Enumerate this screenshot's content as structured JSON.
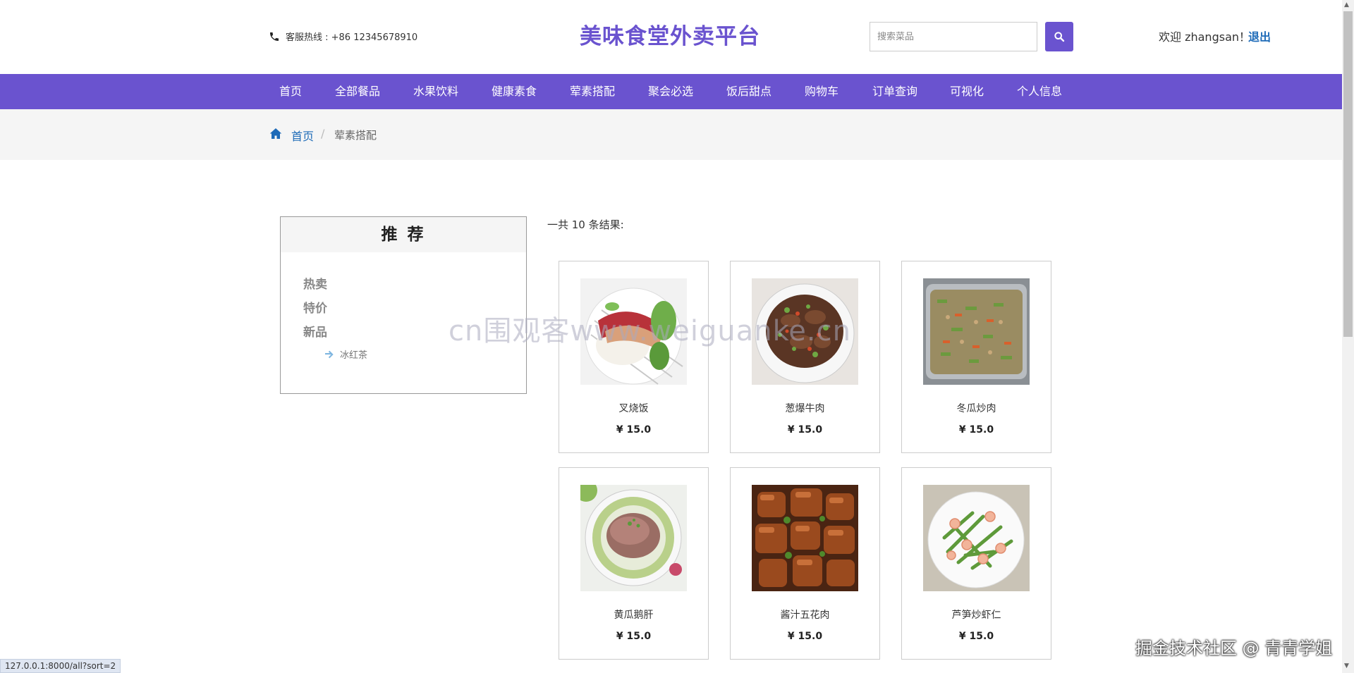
{
  "header": {
    "hotline": "客服热线 : +86 12345678910",
    "title": "美味食堂外卖平台",
    "search_placeholder": "搜索菜品",
    "welcome": "欢迎 zhangsan！",
    "logout": "退出",
    "brand_color": "#6a53cf"
  },
  "nav": [
    "首页",
    "全部餐品",
    "水果饮料",
    "健康素食",
    "荤素搭配",
    "聚会必选",
    "饭后甜点",
    "购物车",
    "订单查询",
    "可视化",
    "个人信息"
  ],
  "breadcrumb": {
    "home": "首页",
    "separator": "/",
    "current": "荤素搭配"
  },
  "sidebar": {
    "title": "推 荐",
    "links": [
      "热卖",
      "特价",
      "新品"
    ],
    "sub_item": "冰红茶"
  },
  "results": {
    "count_text": "一共 10 条结果:",
    "items": [
      {
        "name": "叉烧饭",
        "price": "¥ 15.0"
      },
      {
        "name": "葱爆牛肉",
        "price": "¥ 15.0"
      },
      {
        "name": "冬瓜炒肉",
        "price": "¥ 15.0"
      },
      {
        "name": "黄瓜鹅肝",
        "price": "¥ 15.0"
      },
      {
        "name": "酱汁五花肉",
        "price": "¥ 15.0"
      },
      {
        "name": "芦笋炒虾仁",
        "price": "¥ 15.0"
      }
    ]
  },
  "overlay": {
    "watermark": "cn围观客www.weiguanke.cn",
    "status_url": "127.0.0.1:8000/all?sort=2",
    "credit": "掘金技术社区 @ 青青学姐"
  }
}
